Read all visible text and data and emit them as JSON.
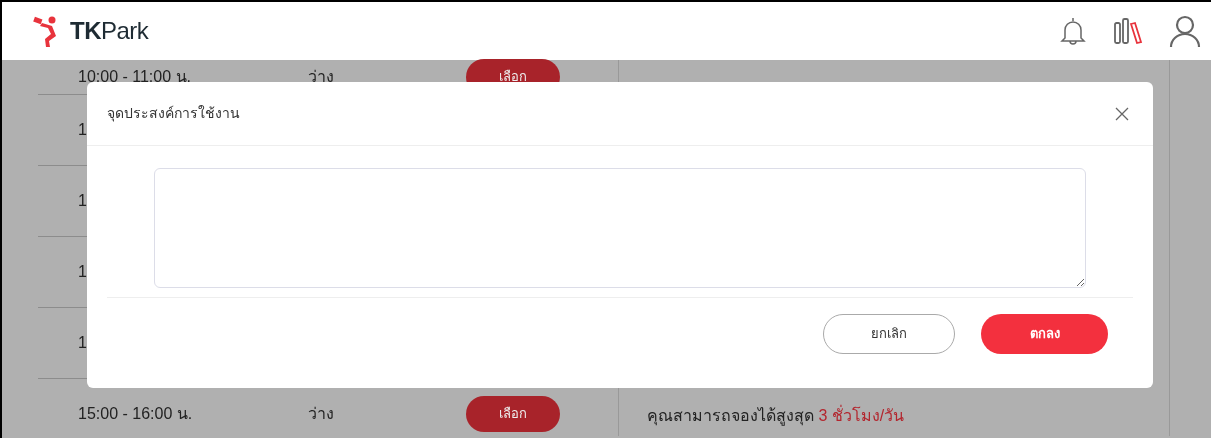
{
  "header": {
    "logo_text_bold": "TK",
    "logo_text": "Park"
  },
  "slots": [
    {
      "time": "10:00 - 11:00 น.",
      "status": "ว่าง",
      "action": "เลือก"
    },
    {
      "time": "1"
    },
    {
      "time": "1"
    },
    {
      "time": "1"
    },
    {
      "time": "1"
    },
    {
      "time": "15:00 - 16:00 น.",
      "status": "ว่าง",
      "action": "เลือก"
    }
  ],
  "quota": {
    "text": "คุณสามารถจองได้สูงสุด",
    "highlight": "3 ชั่วโมง/วัน"
  },
  "modal": {
    "title": "จุดประสงค์การใช้งาน",
    "buttons": [
      {
        "label": "ยกเลิก",
        "kind": "cancel"
      },
      {
        "label": "ตกลง",
        "kind": "confirm"
      }
    ]
  }
}
